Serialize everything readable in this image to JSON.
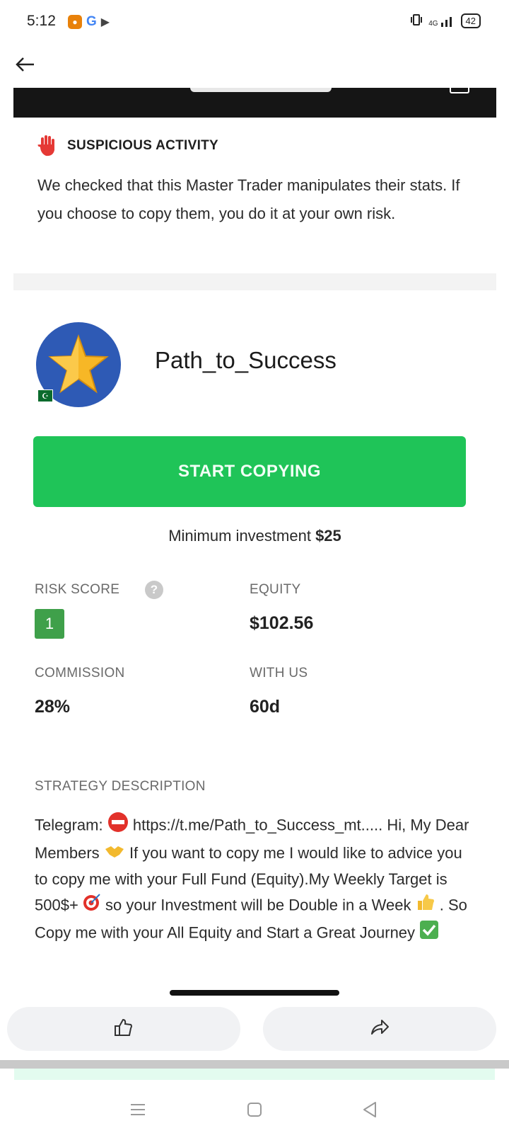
{
  "status_bar": {
    "time": "5:12",
    "network": "4G",
    "battery": "42"
  },
  "warning": {
    "title": "SUSPICIOUS ACTIVITY",
    "text": "We checked that this Master Trader manipulates their stats. If you choose to copy them, you do it at your own risk."
  },
  "trader": {
    "name": "Path_to_Success"
  },
  "start_button_label": "START COPYING",
  "min_investment": {
    "label": "Minimum investment",
    "value": "$25"
  },
  "stats": {
    "risk_score_label": "RISK SCORE",
    "risk_score_value": "1",
    "help_symbol": "?",
    "equity_label": "EQUITY",
    "equity_value": "$102.56",
    "commission_label": "COMMISSION",
    "commission_value": "28%",
    "with_us_label": "WITH US",
    "with_us_value": "60d"
  },
  "strategy": {
    "label": "STRATEGY DESCRIPTION",
    "part1": "Telegram:",
    "part2": "https://t.me/Path_to_Success_mt..... Hi, My Dear Members",
    "part3": "If you want to copy me I would like to advice you to copy me with your Full Fund (Equity).My Weekly Target is 500$+",
    "part4": "so your Investment will be Double in a Week",
    "part5": ". So Copy me with your All Equity and Start a Great Journey"
  },
  "icons": {
    "back": "back-arrow-icon",
    "hand": "raised-hand-icon",
    "like": "thumbs-up-icon",
    "share": "share-icon"
  },
  "colors": {
    "accent_green": "#1fc458",
    "risk_green": "#3fa04a",
    "avatar_blue": "#2e5ab5",
    "dark_header": "#151515"
  }
}
